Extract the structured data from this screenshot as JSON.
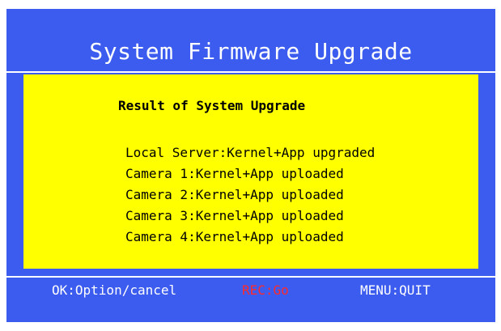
{
  "window": {
    "title": "System Firmware Upgrade"
  },
  "result_panel": {
    "heading": "Result of System Upgrade",
    "items": [
      "Local Server:Kernel+App upgraded",
      "Camera 1:Kernel+App uploaded",
      "Camera 2:Kernel+App uploaded",
      "Camera 3:Kernel+App uploaded",
      "Camera 4:Kernel+App uploaded"
    ]
  },
  "footer": {
    "ok_hint": "OK:Option/cancel",
    "rec_hint": "REC:Go",
    "menu_hint": "MENU:QUIT"
  },
  "colors": {
    "background": "#3c5cf0",
    "panel": "#ffff00",
    "text_primary": "#ffffff",
    "rec_hint": "#ff2a2a"
  }
}
